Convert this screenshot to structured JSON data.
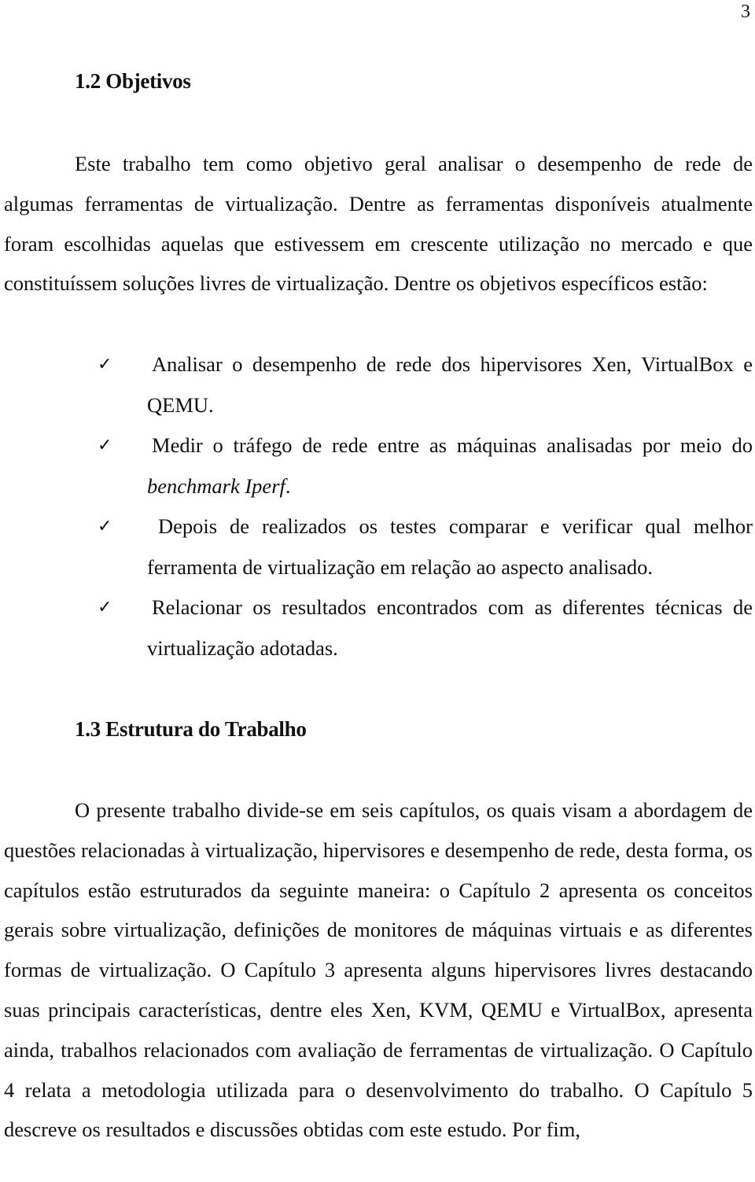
{
  "page": {
    "number": "3"
  },
  "sections": [
    {
      "heading": "1.2 Objetivos",
      "paragraph": "Este trabalho tem como objetivo geral analisar o desempenho de rede de algumas ferramentas de virtualização. Dentre as ferramentas disponíveis atualmente foram escolhidas aquelas que estivessem em crescente utilização no mercado e que constituíssem soluções livres de virtualização. Dentre os objetivos específicos estão:",
      "bullets": [
        {
          "icon": "checkmark-icon",
          "glyph": "✓",
          "text": "Analisar o desempenho de rede dos hipervisores Xen, VirtualBox e QEMU."
        },
        {
          "icon": "checkmark-icon",
          "glyph": "✓",
          "text_before": "Medir o tráfego de rede entre as máquinas analisadas por meio do ",
          "text_italic": "benchmark Iperf",
          "text_after": "."
        },
        {
          "icon": "checkmark-icon",
          "glyph": "✓",
          "text": "Depois de realizados os testes comparar e verificar qual melhor ferramenta de virtualização em relação ao aspecto analisado."
        },
        {
          "icon": "checkmark-icon",
          "glyph": "✓",
          "text": "Relacionar os resultados encontrados com as diferentes técnicas de virtualização adotadas."
        }
      ]
    },
    {
      "heading": "1.3 Estrutura do Trabalho",
      "paragraph": "O presente trabalho divide-se em seis capítulos, os quais visam a abordagem de questões relacionadas à virtualização, hipervisores e desempenho de rede, desta forma, os capítulos estão estruturados da seguinte maneira: o Capítulo 2 apresenta os conceitos gerais sobre virtualização, definições de monitores de máquinas virtuais e as diferentes formas de virtualização. O Capítulo 3 apresenta alguns hipervisores livres destacando suas principais características, dentre eles Xen, KVM, QEMU e VirtualBox, apresenta ainda, trabalhos relacionados com avaliação de ferramentas de virtualização. O Capítulo 4 relata a metodologia utilizada para o desenvolvimento do trabalho. O Capítulo 5 descreve os resultados e discussões obtidas com este estudo. Por fim,"
    }
  ]
}
